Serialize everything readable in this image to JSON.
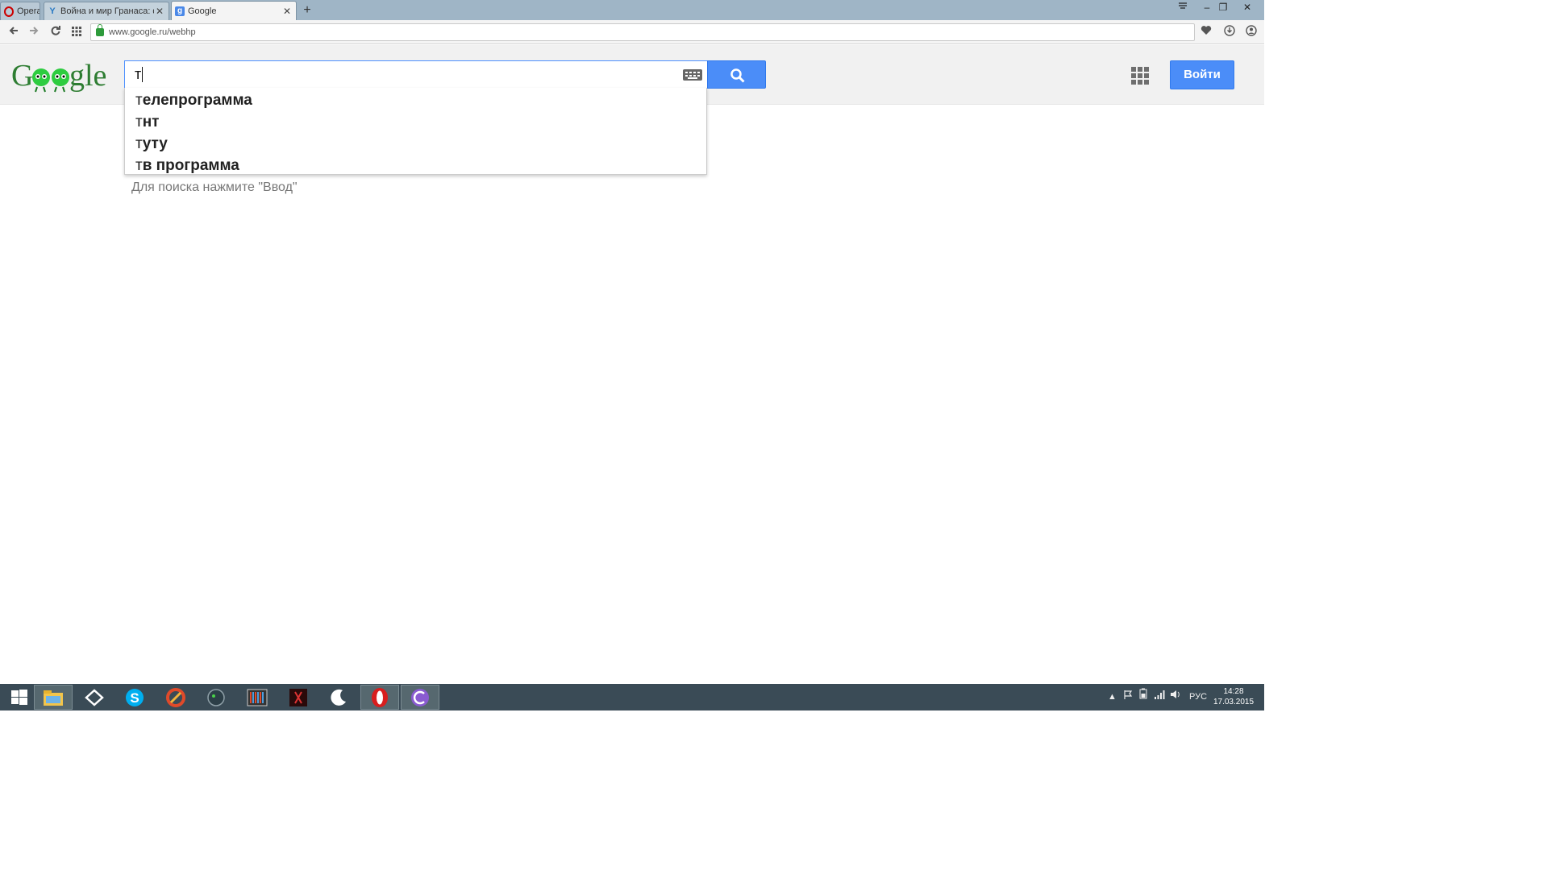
{
  "browser": {
    "opera_button_label": "Opera",
    "tabs": [
      {
        "title": "Война и мир Гранаса: фи",
        "favicon": "yandex-icon"
      },
      {
        "title": "Google",
        "favicon": "google-icon"
      }
    ],
    "new_tab_label": "+",
    "url": "www.google.ru/webhp"
  },
  "google": {
    "search_value": "т",
    "login_label": "Войти",
    "suggestions": [
      {
        "typed": "т",
        "rest": "елепрограмма"
      },
      {
        "typed": "т",
        "rest": "нт"
      },
      {
        "typed": "т",
        "rest": "уту"
      },
      {
        "typed": "т",
        "rest": "в программа"
      }
    ],
    "hint": "Для поиска нажмите \"Ввод\""
  },
  "taskbar": {
    "language": "РУС",
    "time": "14:28",
    "date": "17.03.2015"
  },
  "colors": {
    "tab_strip": "#9fb5c6",
    "google_blue": "#4b8df8",
    "taskbar": "#3a4b56"
  }
}
